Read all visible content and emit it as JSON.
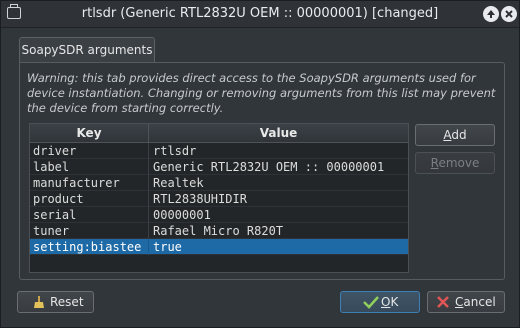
{
  "window": {
    "title": "rtlsdr (Generic RTL2832U OEM :: 00000001) [changed]"
  },
  "tabs": [
    {
      "label": "SoapySDR arguments"
    }
  ],
  "warning": "Warning: this tab provides direct access to the SoapySDR arguments used for device instantiation. Changing or removing arguments from this list may prevent the device from starting correctly.",
  "table": {
    "columns": [
      "Key",
      "Value"
    ],
    "rows": [
      {
        "key": "driver",
        "value": "rtlsdr"
      },
      {
        "key": "label",
        "value": "Generic RTL2832U OEM :: 00000001"
      },
      {
        "key": "manufacturer",
        "value": "Realtek"
      },
      {
        "key": "product",
        "value": "RTL2838UHIDIR"
      },
      {
        "key": "serial",
        "value": "00000001"
      },
      {
        "key": "tuner",
        "value": "Rafael Micro R820T"
      },
      {
        "key": "setting:biastee",
        "value": "true",
        "selected": true
      }
    ]
  },
  "buttons": {
    "add_first": "A",
    "add_rest": "dd",
    "remove_first": "R",
    "remove_rest": "emove",
    "reset": "Reset",
    "ok_first": "O",
    "ok_rest": "K",
    "cancel_first": "C",
    "cancel_rest": "ancel"
  },
  "colors": {
    "selection": "#1e6aa6",
    "background": "#31363b"
  }
}
